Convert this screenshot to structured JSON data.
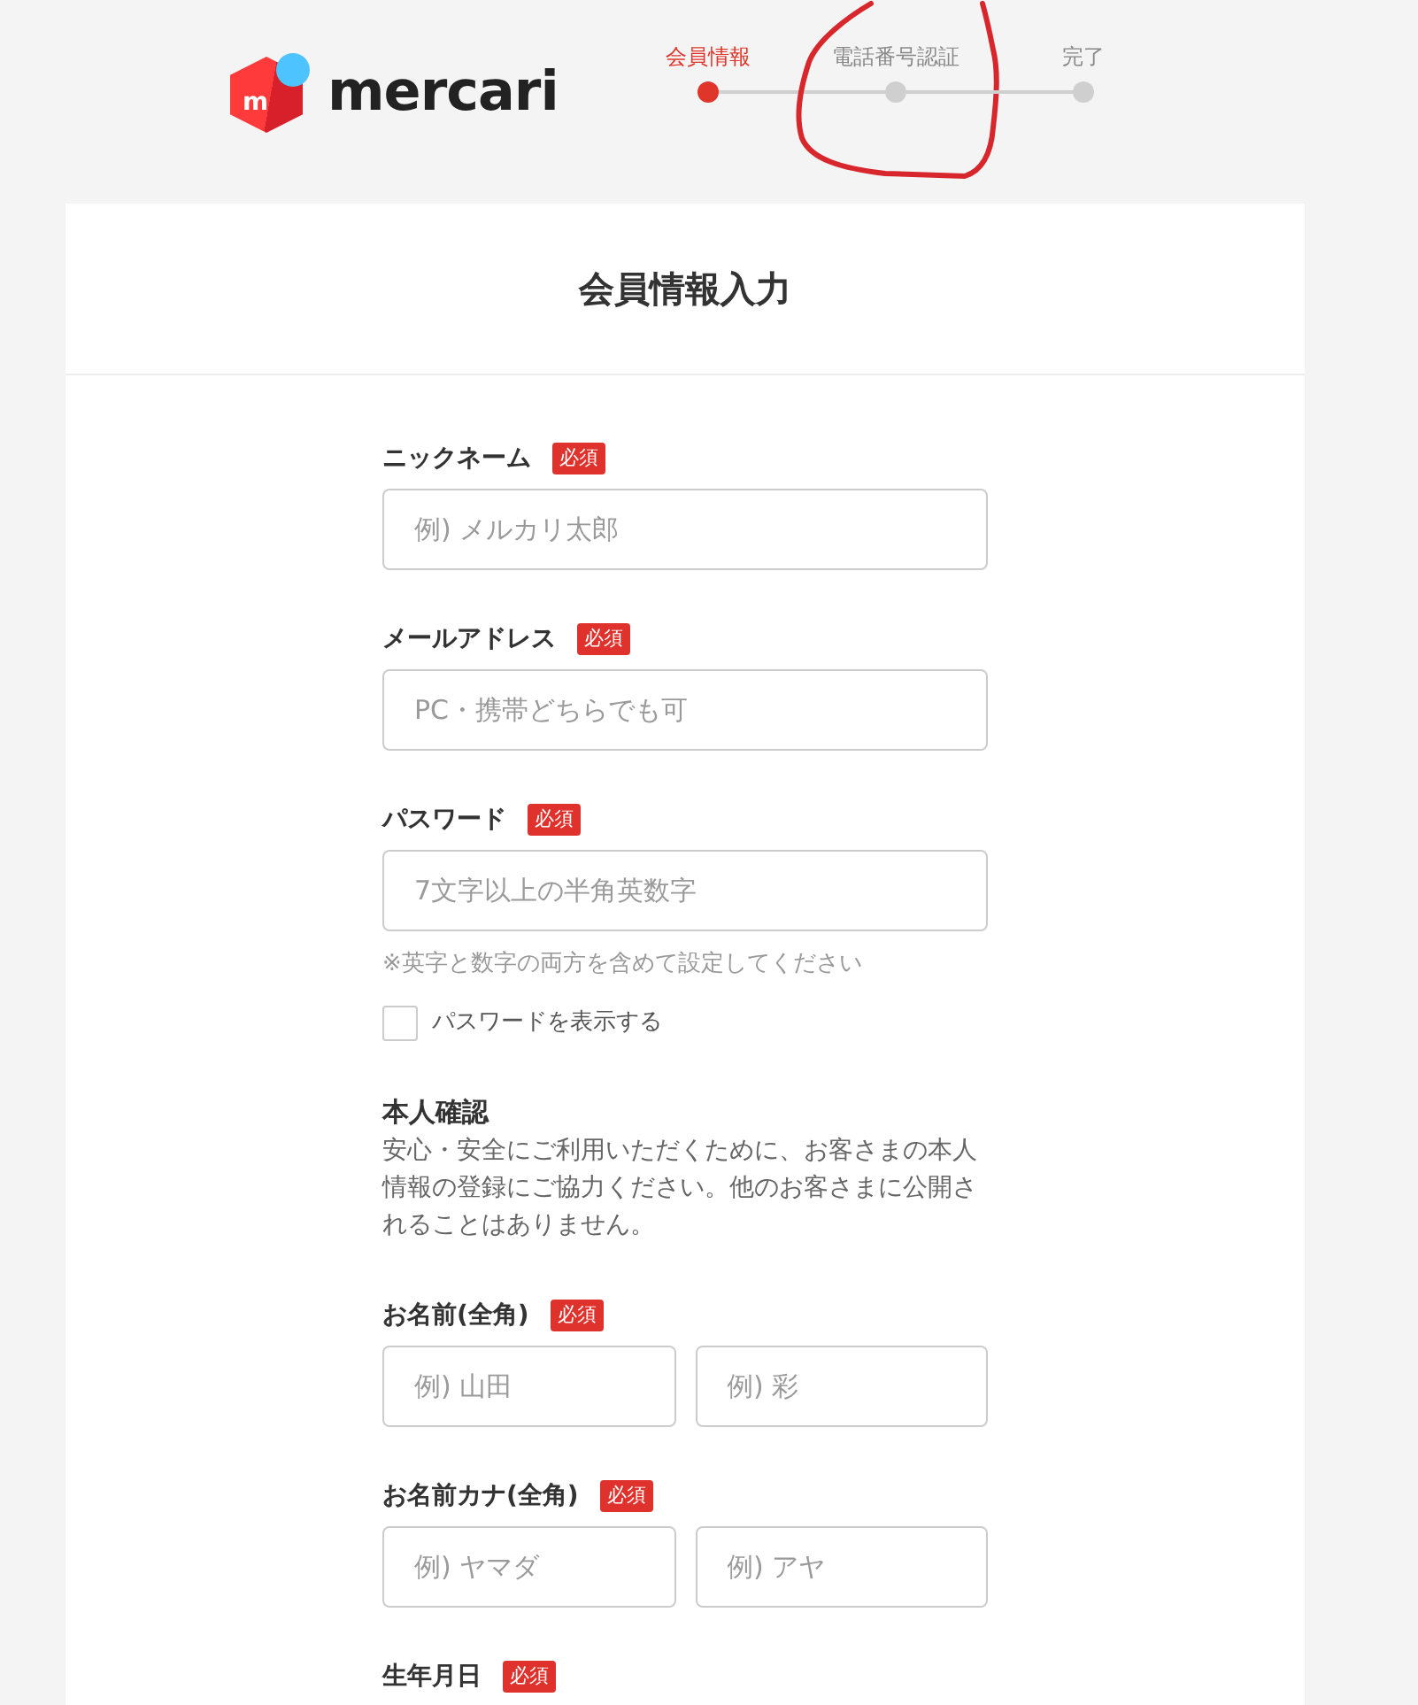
{
  "logo": {
    "mark": "m",
    "wordmark": "mercari"
  },
  "steps": [
    {
      "label": "会員情報",
      "selected": true,
      "circled": false
    },
    {
      "label": "電話番号認証",
      "selected": false,
      "circled": true
    },
    {
      "label": "完了",
      "selected": false,
      "circled": false
    }
  ],
  "form": {
    "title": "会員情報入力",
    "items": [
      {
        "kind": "field",
        "label": "ニックネーム",
        "badge": "必須",
        "inputs": [
          {
            "placeholder": "例) メルカリ太郎"
          }
        ]
      },
      {
        "kind": "field",
        "label": "メールアドレス",
        "badge": "必須",
        "inputs": [
          {
            "placeholder": "PC・携帯どちらでも可"
          }
        ]
      },
      {
        "kind": "field",
        "label": "パスワード",
        "badge": "必須",
        "inputs": [
          {
            "placeholder": "7文字以上の半角英数字"
          }
        ],
        "note": "※英字と数字の両方を含めて設定してください",
        "checkbox": {
          "label": "パスワードを表示する",
          "checked": false
        }
      },
      {
        "kind": "intro",
        "title": "本人確認",
        "text": "安心・安全にご利用いただくために、お客さまの本人情報の登録にご協力ください。他のお客さまに公開されることはありません。"
      },
      {
        "kind": "field",
        "label": "お名前(全角)",
        "badge": "必須",
        "inputs": [
          {
            "placeholder": "例) 山田"
          },
          {
            "placeholder": "例) 彩"
          }
        ]
      },
      {
        "kind": "field",
        "label": "お名前カナ(全角)",
        "badge": "必須",
        "inputs": [
          {
            "placeholder": "例) ヤマダ"
          },
          {
            "placeholder": "例) アヤ"
          }
        ]
      },
      {
        "kind": "field",
        "label": "生年月日",
        "badge": "必須"
      }
    ]
  }
}
